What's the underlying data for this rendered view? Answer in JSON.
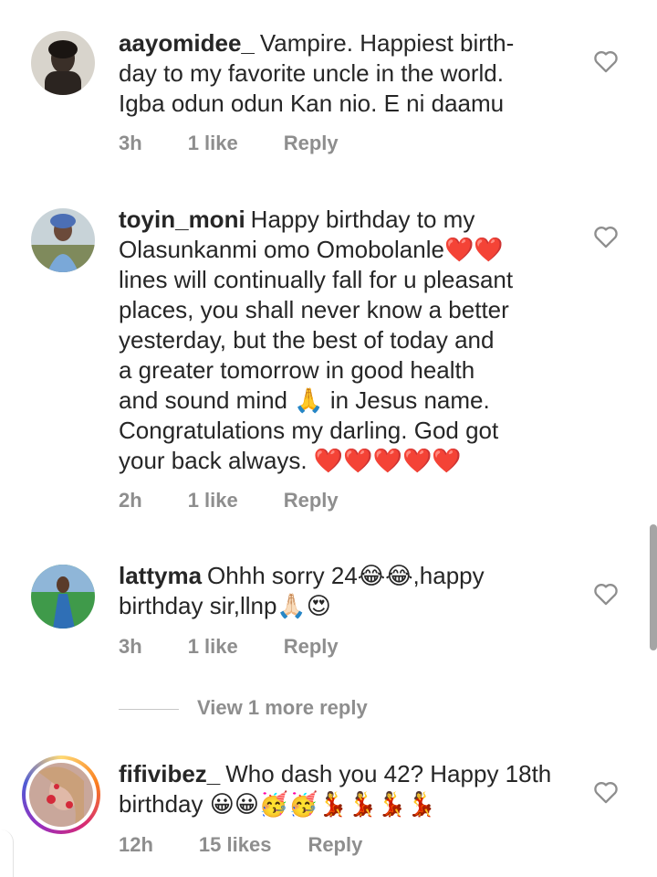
{
  "comments": [
    {
      "username": "aayomidee_",
      "text_lines": [
        "Vampire. Happiest birth-",
        "day to my favorite uncle in the world.",
        "Igba odun odun Kan nio. E ni daamu"
      ],
      "time": "3h",
      "likes": "1 like",
      "reply": "Reply"
    },
    {
      "username": "toyin_moni",
      "text_lines": [
        "Happy birthday to my",
        "Olasunkanmi omo Omobolanle❤️❤️",
        "lines will continually fall for u pleasant",
        "places, you shall never know a better",
        "yesterday, but the best of today and",
        "a greater tomorrow in good health",
        "and sound mind 🙏 in Jesus name.",
        "Congratulations my darling. God got",
        "your back always. ❤️❤️❤️❤️❤️"
      ],
      "time": "2h",
      "likes": "1 like",
      "reply": "Reply"
    },
    {
      "username": "lattyma",
      "text_lines": [
        "Ohhh sorry 24😂😂,happy",
        "birthday sir,llnp🙏🏻😍"
      ],
      "time": "3h",
      "likes": "1 like",
      "reply": "Reply"
    },
    {
      "username": "fifivibez_",
      "text_lines": [
        "Who dash you 42? Happy 18th",
        "birthday 😀😀🥳🥳💃💃💃💃"
      ],
      "time": "12h",
      "likes": "15 likes",
      "reply": "Reply"
    }
  ],
  "view_more_replies": "View 1 more reply",
  "colors": {
    "text": "#262626",
    "meta": "#8e8e8e",
    "heart_outline": "#8e8e8e"
  },
  "icons": {
    "like": "heart-outline-icon"
  }
}
